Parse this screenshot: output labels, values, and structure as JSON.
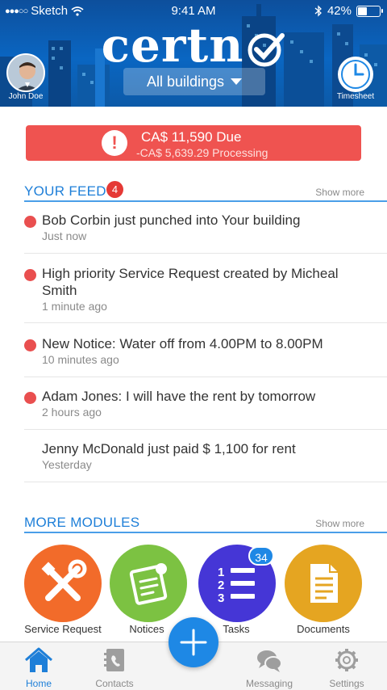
{
  "status_bar": {
    "carrier": "Sketch",
    "time": "9:41 AM",
    "battery": "42%",
    "battery_level": 0.42
  },
  "header": {
    "logo_text": "certn",
    "building_selector": "All buildings",
    "user_name": "John Doe",
    "timesheet_label": "Timesheet"
  },
  "due_banner": {
    "amount_due": "CA$ 11,590 Due",
    "processing": "-CA$ 5,639.29 Processing",
    "alert_glyph": "!"
  },
  "feed": {
    "title": "YOUR FEED",
    "count": "4",
    "show_more": "Show more",
    "items": [
      {
        "text": "Bob Corbin just punched into Your building",
        "time": "Just now",
        "unread": true
      },
      {
        "text": "High priority Service Request created by Micheal Smith",
        "time": "1 minute ago",
        "unread": true
      },
      {
        "text": "New Notice: Water off from 4.00PM to 8.00PM",
        "time": "10 minutes ago",
        "unread": true
      },
      {
        "text": "Adam Jones: I will have the rent by tomorrow",
        "time": "2 hours ago",
        "unread": true
      },
      {
        "text": "Jenny McDonald just paid $ 1,100 for rent",
        "time": "Yesterday",
        "unread": false
      }
    ]
  },
  "modules": {
    "title": "MORE MODULES",
    "show_more": "Show more",
    "items": [
      {
        "label": "Service Request",
        "icon": "tools-icon",
        "color": "#f26b2a"
      },
      {
        "label": "Notices",
        "icon": "notice-icon",
        "color": "#7cc242"
      },
      {
        "label": "Tasks",
        "icon": "numbered-list-icon",
        "color": "#4536d6",
        "badge": "34"
      },
      {
        "label": "Documents",
        "icon": "document-icon",
        "color": "#e5a521"
      }
    ]
  },
  "tabbar": {
    "items": [
      {
        "label": "Home",
        "icon": "home-icon",
        "active": true
      },
      {
        "label": "Contacts",
        "icon": "contacts-icon",
        "active": false
      },
      {
        "label": "Messaging",
        "icon": "chat-bubbles-icon",
        "active": false
      },
      {
        "label": "Settings",
        "icon": "gear-icon",
        "active": false
      }
    ],
    "fab_icon": "plus-icon"
  },
  "colors": {
    "accent": "#1e7fd8",
    "alert_red": "#ef5350",
    "header_blue": "#0a66c2"
  }
}
